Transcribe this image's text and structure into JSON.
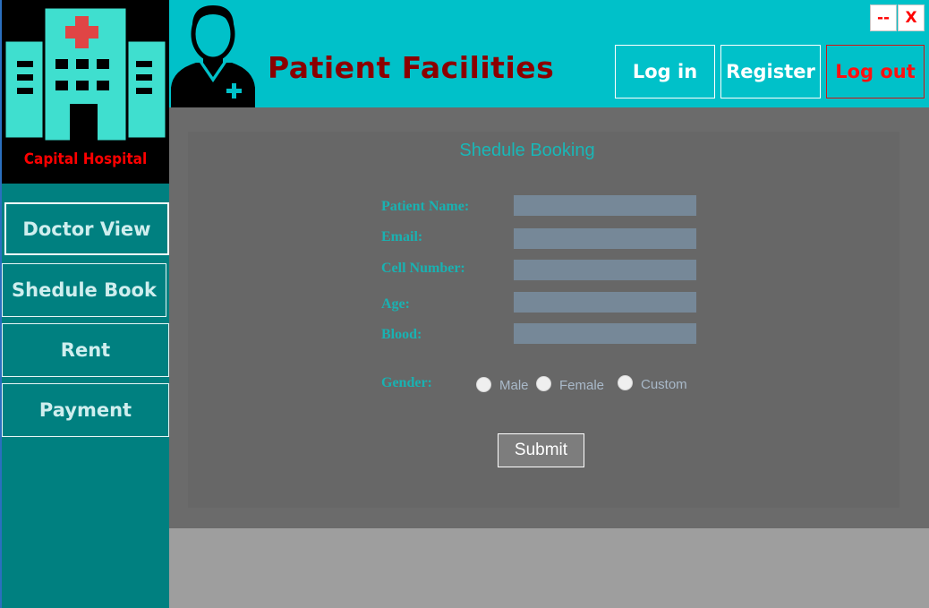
{
  "window": {
    "minimize_label": "--",
    "close_label": "X"
  },
  "sidebar": {
    "logo_text": "Capital Hospital",
    "items": [
      {
        "label": "Doctor View",
        "active": true
      },
      {
        "label": "Shedule Book",
        "active": false
      },
      {
        "label": "Rent",
        "active": false
      },
      {
        "label": "Payment",
        "active": false
      }
    ]
  },
  "header": {
    "title": "Patient Facilities",
    "login_label": "Log in",
    "register_label": "Register",
    "logout_label": "Log out"
  },
  "form": {
    "title": "Shedule Booking",
    "fields": [
      {
        "label": "Patient Name:",
        "value": ""
      },
      {
        "label": "Email:",
        "value": ""
      },
      {
        "label": "Cell Number:",
        "value": ""
      },
      {
        "label": "Age:",
        "value": ""
      },
      {
        "label": "Blood:",
        "value": ""
      }
    ],
    "gender_label": "Gender:",
    "gender_options": [
      "Male",
      "Female",
      "Custom"
    ],
    "submit_label": "Submit"
  },
  "colors": {
    "sidebar_bg": "#008080",
    "header_bg": "#00c1c9",
    "title": "#8b0000",
    "logout": "#ff1010",
    "accent": "#19b2b2"
  }
}
